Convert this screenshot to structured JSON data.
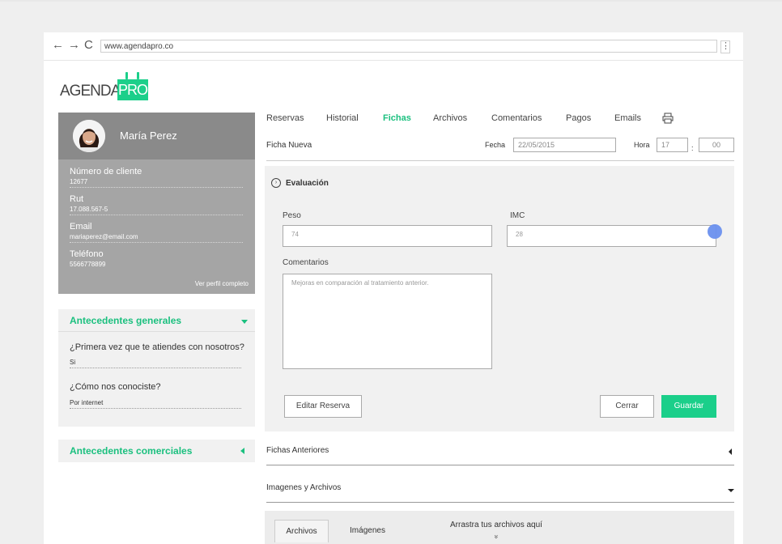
{
  "browser": {
    "url": "www.agendapro.co",
    "back": "←",
    "forward": "→",
    "reload": "C",
    "menu": "⋮"
  },
  "logo": {
    "agenda": "AGENDA",
    "pro": "PRO"
  },
  "profile": {
    "name": "María Perez",
    "fields": [
      {
        "label": "Número de cliente",
        "value": "12677"
      },
      {
        "label": "Rut",
        "value": "17.088.567-5"
      },
      {
        "label": "Email",
        "value": "mariaperez@email.com"
      },
      {
        "label": "Teléfono",
        "value": "5566778899"
      }
    ],
    "link": "Ver perfil completo"
  },
  "general": {
    "title": "Antecedentes generales",
    "q1": "¿Primera vez que te atiendes con nosotros?",
    "a1": "Si",
    "q2": "¿Cómo nos conociste?",
    "a2": "Por internet"
  },
  "commercial": {
    "title": "Antecedentes comerciales"
  },
  "tabs": [
    "Reservas",
    "Historial",
    "Fichas",
    "Archivos",
    "Comentarios",
    "Pagos",
    "Emails"
  ],
  "active_tab": "Fichas",
  "ficha": {
    "label": "Ficha Nueva",
    "fecha_label": "Fecha",
    "fecha": "22/05/2015",
    "hora_label": "Hora",
    "hora": "17",
    "sep": ":",
    "min": "00"
  },
  "evaluacion": {
    "title": "Evaluación",
    "peso_label": "Peso",
    "peso": "74",
    "imc_label": "IMC",
    "imc": "28",
    "comentarios_label": "Comentarios",
    "comentarios": "Mejoras en comparación al tratamiento anterior."
  },
  "buttons": {
    "editar": "Editar Reserva",
    "cerrar": "Cerrar",
    "guardar": "Guardar"
  },
  "sections": {
    "anteriores": "Fichas Anteriores",
    "imagenes": "Imagenes y Archivos"
  },
  "upload": {
    "tab_archivos": "Archivos",
    "tab_imagenes": "Imágenes",
    "drop": "Arrastra tus archivos aquí",
    "drop_icon": "»"
  },
  "colors": {
    "accent": "#1bcf8a",
    "profile_bg": "#a5a5a5",
    "profile_head": "#8a8a8a"
  }
}
